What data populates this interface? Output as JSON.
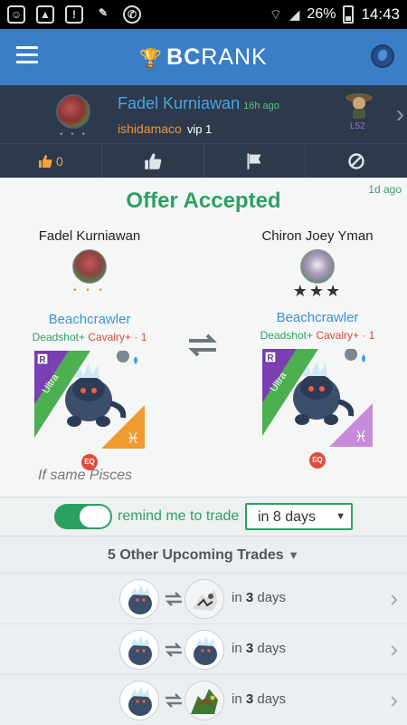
{
  "status_bar": {
    "battery": "26%",
    "time": "14:43",
    "icons": [
      "bbm-icon",
      "image-icon",
      "alert-icon",
      "cleaner-icon",
      "whatsapp-icon",
      "wifi-icon",
      "signal-icon"
    ]
  },
  "app_bar": {
    "brand_bold": "BC",
    "brand_rest": "RANK",
    "brand_color": "#3a7ec6"
  },
  "user": {
    "name": "Fadel Kurniawan",
    "ago": "16h ago",
    "handle": "ishidamaco",
    "vip": "vip 1",
    "level": "L52",
    "likes_count": "0"
  },
  "offer": {
    "title": "Offer Accepted",
    "ago": "1d ago",
    "left": {
      "player": "Fadel Kurniawan",
      "monster": "Beachcrawler",
      "skill_green": "Deadshot+",
      "skill_red": "Cavalry+ · 1",
      "rarity": "Ultra",
      "rarity_letter": "R",
      "badge": "EQ"
    },
    "right": {
      "player": "Chiron Joey Yman",
      "stars": "★★★",
      "monster": "Beachcrawler",
      "skill_green": "Deadshot+",
      "skill_red": "Cavalry+ · 1",
      "rarity": "Ultra",
      "rarity_letter": "R",
      "badge": "EQ"
    },
    "note": "If same Pisces"
  },
  "remind": {
    "label": "remind me to trade",
    "selected": "in 8 days",
    "enabled": true
  },
  "upcoming": {
    "title": "5 Other Upcoming Trades",
    "rows": [
      {
        "prefix": "in ",
        "count": "3",
        "suffix": " days"
      },
      {
        "prefix": "in ",
        "count": "3",
        "suffix": " days"
      },
      {
        "prefix": "in ",
        "count": "3",
        "suffix": " days"
      }
    ]
  }
}
